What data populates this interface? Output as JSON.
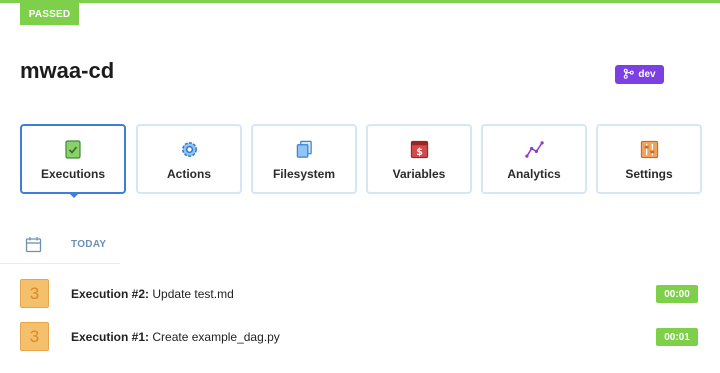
{
  "status": {
    "label": "PASSED",
    "color": "#7ed04b"
  },
  "pipeline": {
    "title": "mwaa-cd"
  },
  "environment": {
    "label": "dev",
    "icon": "branch-icon",
    "color": "#7b3fe4"
  },
  "tabs": [
    {
      "label": "Executions",
      "icon": "executions-icon",
      "active": true
    },
    {
      "label": "Actions",
      "icon": "gear-icon",
      "active": false
    },
    {
      "label": "Filesystem",
      "icon": "files-icon",
      "active": false
    },
    {
      "label": "Variables",
      "icon": "variables-icon",
      "active": false
    },
    {
      "label": "Analytics",
      "icon": "analytics-icon",
      "active": false
    },
    {
      "label": "Settings",
      "icon": "settings-icon",
      "active": false
    }
  ],
  "date_group": {
    "label": "TODAY",
    "icon": "calendar-icon"
  },
  "executions": [
    {
      "number": "3",
      "title": "Execution #2:",
      "message": "Update test.md",
      "duration": "00:00"
    },
    {
      "number": "3",
      "title": "Execution #1:",
      "message": "Create example_dag.py",
      "duration": "00:01"
    }
  ]
}
